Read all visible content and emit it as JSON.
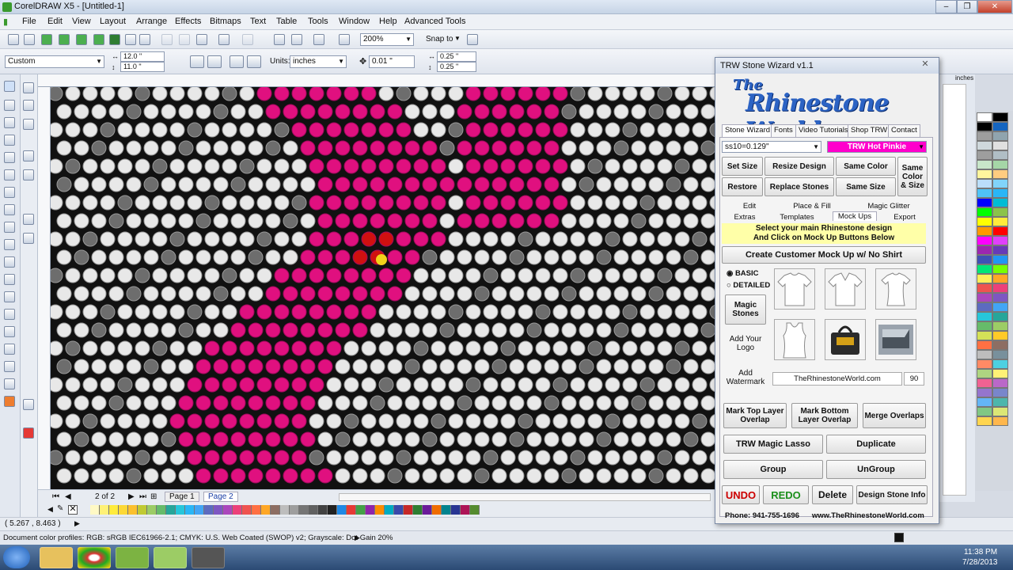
{
  "window": {
    "title": "CorelDRAW X5 - [Untitled-1]"
  },
  "menu": [
    "File",
    "Edit",
    "View",
    "Layout",
    "Arrange",
    "Effects",
    "Bitmaps",
    "Text",
    "Table",
    "Tools",
    "Window",
    "Help",
    "Advanced Tools"
  ],
  "toolbar": {
    "zoom": "200%",
    "snap": "Snap to"
  },
  "propbar": {
    "paper": "Custom",
    "width": "12.0 \"",
    "height": "11.0 \"",
    "units_label": "Units:",
    "units": "inches",
    "nudge": "0.01 \"",
    "dup_x": "0.25 \"",
    "dup_y": "0.25 \""
  },
  "pagenav": {
    "counter": "2 of 2",
    "pages": [
      "Page 1",
      "Page 2"
    ]
  },
  "status": {
    "coords": "( 5.267 , 8.463 )",
    "profiles": "Document color profiles: RGB: sRGB IEC61966-2.1; CMYK: U.S. Web Coated (SWOP) v2; Grayscale: Dot Gain 20%"
  },
  "ruler_units": "inches",
  "clock": {
    "time": "11:38 PM",
    "date": "7/28/2013"
  },
  "wizard": {
    "title": "TRW Stone Wizard v1.1",
    "logo_the": "The",
    "logo": "Rhinestone World",
    "tabs": [
      "Stone Wizard",
      "Fonts",
      "Video Tutorials",
      "Shop TRW",
      "Contact"
    ],
    "size_select": "ss10=0.129\"",
    "color_select": "TRW Hot Pinkie",
    "buttons": {
      "set_size": "Set Size",
      "resize": "Resize Design",
      "same_color": "Same Color",
      "same_color_size": "Same Color & Size",
      "restore": "Restore",
      "replace": "Replace Stones",
      "same_size": "Same Size"
    },
    "subtabs_row1": [
      "Edit",
      "Place & Fill",
      "Magic Glitter"
    ],
    "subtabs_row2": [
      "Extras",
      "Templates",
      "Mock Ups",
      "Export"
    ],
    "notice_line1": "Select your main Rhinestone design",
    "notice_line2": "And Click on Mock Up Buttons Below",
    "mockup_btn": "Create Customer Mock Up w/ No Shirt",
    "radio_basic": "BASIC",
    "radio_detailed": "DETAILED",
    "magic_stones": "Magic Stones",
    "add_logo": "Add Your Logo",
    "add_watermark": "Add Watermark",
    "watermark_text": "TheRhinestoneWorld.com",
    "watermark_value": "90",
    "mark_top": "Mark Top Layer Overlap",
    "mark_bottom": "Mark Bottom Layer Overlap",
    "merge": "Merge Overlaps",
    "lasso": "TRW Magic Lasso",
    "duplicate": "Duplicate",
    "group": "Group",
    "ungroup": "UnGroup",
    "undo": "UNDO",
    "redo": "REDO",
    "delete": "Delete",
    "design_info": "Design Stone Info",
    "footer": "Phone: 941-755-1696      www.TheRhinestoneWorld.com"
  },
  "colors": {
    "pink": "#e0107f",
    "undo": "#cc0000",
    "redo": "#1b8f1b",
    "selected_color_bg": "#ff00cc"
  }
}
